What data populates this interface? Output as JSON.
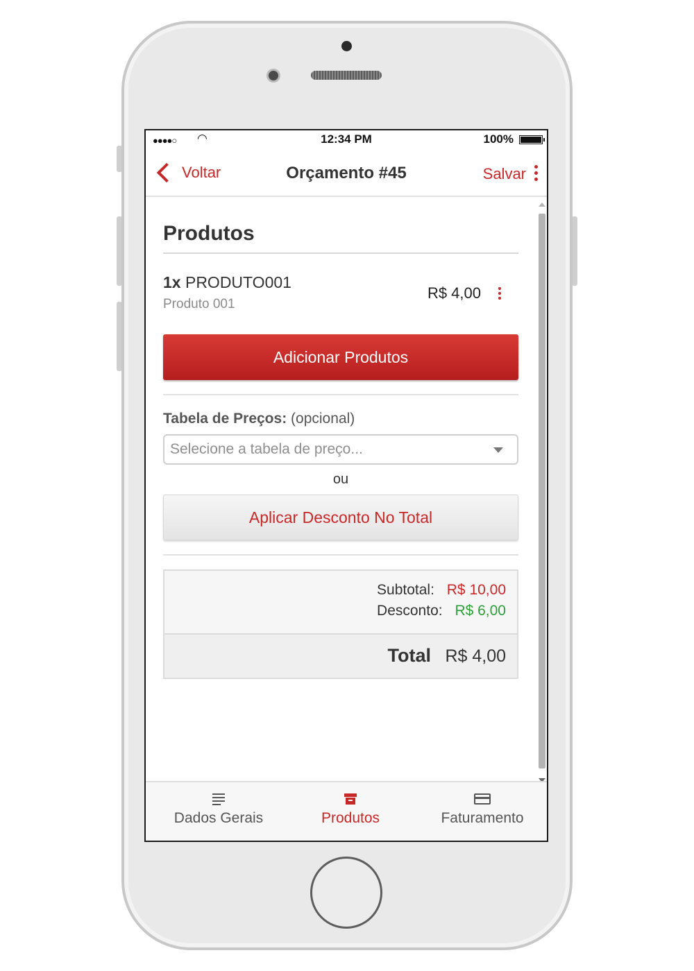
{
  "status_bar": {
    "signal": "●●●●○",
    "wifi": "◠",
    "time": "12:34 PM",
    "battery": "100%"
  },
  "nav": {
    "back_label": "Voltar",
    "title": "Orçamento #45",
    "save_label": "Salvar"
  },
  "section_title": "Produtos",
  "product": {
    "qty": "1x",
    "code": "PRODUTO001",
    "name": "Produto 001",
    "price": "R$ 4,00"
  },
  "add_button": "Adicionar Produtos",
  "price_table": {
    "label": "Tabela de Preços:",
    "optional": "(opcional)",
    "placeholder": "Selecione a tabela de preço..."
  },
  "or_text": "ou",
  "discount_button": "Aplicar Desconto No Total",
  "totals": {
    "subtotal_label": "Subtotal:",
    "subtotal_value": "R$ 10,00",
    "discount_label": "Desconto:",
    "discount_value": "R$ 6,00",
    "total_label": "Total",
    "total_value": "R$ 4,00"
  },
  "tabs": [
    {
      "label": "Dados Gerais",
      "icon": "list-icon",
      "active": false
    },
    {
      "label": "Produtos",
      "icon": "box-icon",
      "active": true
    },
    {
      "label": "Faturamento",
      "icon": "credit-card-icon",
      "active": false
    }
  ],
  "colors": {
    "accent": "#c62828",
    "success": "#2e9e3a"
  }
}
